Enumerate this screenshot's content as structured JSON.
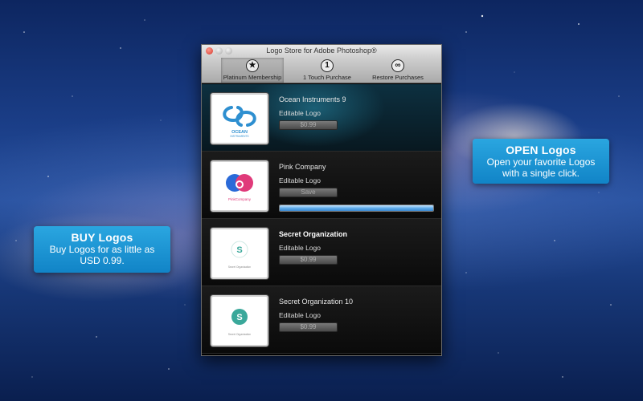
{
  "callouts": {
    "buy": {
      "title": "BUY Logos",
      "lines": [
        "Buy Logos for as little as",
        "USD 0.99."
      ]
    },
    "open": {
      "title": "OPEN Logos",
      "lines": [
        "Open your favorite Logos",
        "with a single click."
      ]
    }
  },
  "window": {
    "title": "Logo Store for Adobe Photoshop®",
    "toolbar": [
      {
        "label": "Platinum Membership",
        "icon": "star-icon",
        "glyph": "★",
        "active": true
      },
      {
        "label": "1 Touch Purchase",
        "icon": "one-touch-icon",
        "glyph": "1",
        "active": false
      },
      {
        "label": "Restore Purchases",
        "icon": "infinity-icon",
        "glyph": "∞",
        "active": false
      }
    ]
  },
  "items": [
    {
      "name": "Ocean Instruments 9",
      "sublabel": "Editable Logo",
      "button": "$0.99",
      "selected": true,
      "name_bold": false,
      "thumb": {
        "kind": "ocean",
        "caption": "OCEAN",
        "subcaption": "INSTRUMENTS"
      }
    },
    {
      "name": "Pink Company",
      "sublabel": "Editable Logo",
      "button": "Save",
      "selected": false,
      "name_bold": false,
      "progress": 1.0,
      "thumb": {
        "kind": "pink",
        "caption": "PinkCompany"
      }
    },
    {
      "name": "Secret Organization",
      "sublabel": "Editable Logo",
      "button": "$0.99",
      "selected": false,
      "name_bold": true,
      "thumb": {
        "kind": "secret-outline",
        "caption": "Secret Organization",
        "letter": "S"
      }
    },
    {
      "name": "Secret Organization 10",
      "sublabel": "Editable Logo",
      "button": "$0.99",
      "selected": false,
      "name_bold": false,
      "thumb": {
        "kind": "secret-filled",
        "caption": "Secret Organization",
        "letter": "S"
      }
    }
  ],
  "colors": {
    "callout": "#1a8fd0",
    "ocean_logo": "#2e8fd0",
    "pink_logo": "#e03a7a",
    "pink_logo_blue": "#2a6ad8",
    "secret_logo": "#3aa89a",
    "progress": "#5aa8e8"
  }
}
